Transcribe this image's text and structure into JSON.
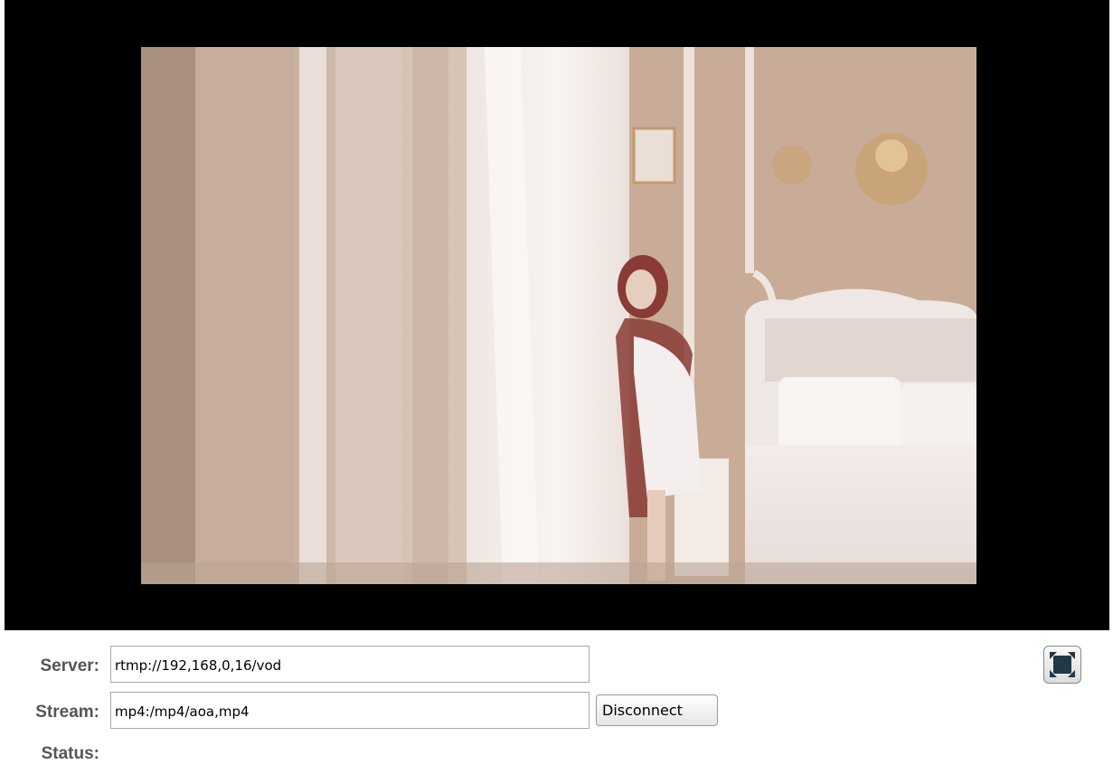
{
  "player": {
    "video_description_icon": "video-frame"
  },
  "controls": {
    "server_label": "Server:",
    "server_value": "rtmp://192,168,0,16/vod",
    "stream_label": "Stream:",
    "stream_value": "mp4:/mp4/aoa,mp4",
    "disconnect_label": "Disconnect",
    "status_label": "Status:",
    "status_value": "",
    "fullscreen_icon": "fullscreen-icon"
  }
}
